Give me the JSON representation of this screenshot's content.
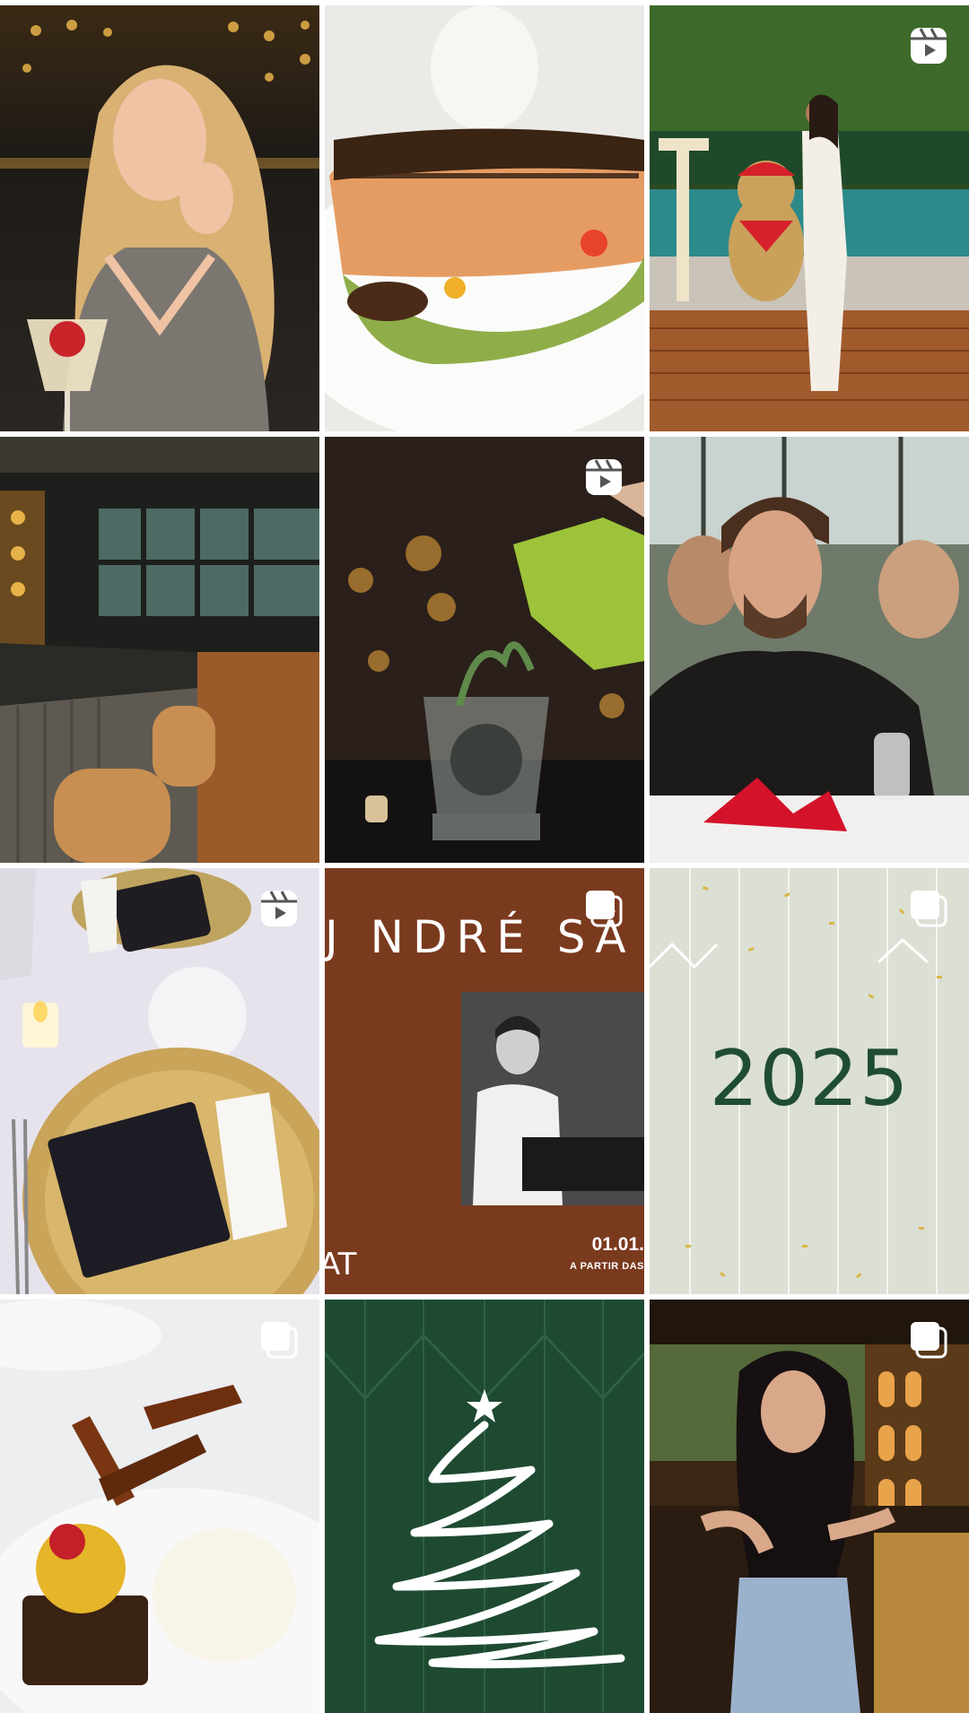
{
  "feed": {
    "posts": [
      {
        "name": "post-woman-cocktail",
        "type": "photo"
      },
      {
        "name": "post-salmon-dish",
        "type": "photo"
      },
      {
        "name": "post-woman-pool-bear",
        "type": "reel"
      },
      {
        "name": "post-restaurant-bar",
        "type": "photo"
      },
      {
        "name": "post-cocktail-pour",
        "type": "reel"
      },
      {
        "name": "post-man-dinner",
        "type": "photo"
      },
      {
        "name": "post-table-setting",
        "type": "reel"
      },
      {
        "name": "post-dj-andre-sa",
        "type": "carousel",
        "title_text": "J  NDRÉ SÁ",
        "date_text": "01.01.",
        "sub_text": "A PARTIR DAS",
        "logo_text": "AT"
      },
      {
        "name": "post-2025",
        "type": "carousel",
        "headline": "2025"
      },
      {
        "name": "post-dessert",
        "type": "carousel"
      },
      {
        "name": "post-christmas-tree",
        "type": "photo"
      },
      {
        "name": "post-woman-bar",
        "type": "carousel"
      }
    ]
  },
  "colors": {
    "dj_background": "#7a3a1e",
    "year_background": "#dcdfd4",
    "year_text": "#1f4d33",
    "tree_background": "#1e4a32"
  },
  "icons": {
    "reel": "reel-icon",
    "carousel": "carousel-icon"
  }
}
